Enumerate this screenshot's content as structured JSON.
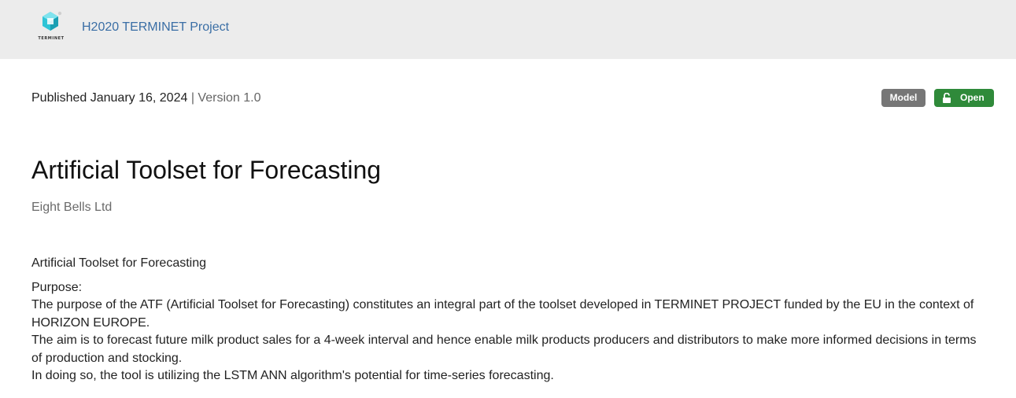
{
  "header": {
    "logo_text": "TERMINET",
    "community_label": "H2020 TERMINET Project",
    "brand_color": "#2ec4d6"
  },
  "record": {
    "published_label": "Published January 16, 2024",
    "version_label": "| Version 1.0",
    "badges": {
      "type": "Model",
      "access": "Open",
      "access_icon": "unlock-icon",
      "type_color": "#767676",
      "access_color": "#2f8a3a"
    },
    "title": "Artificial Toolset for Forecasting",
    "creator": "Eight Bells Ltd",
    "description": {
      "heading": "Artificial Toolset for Forecasting",
      "purpose_label": "Purpose:",
      "line1": "The purpose of the ATF (Artificial Toolset for Forecasting) constitutes an integral part of the toolset developed in TERMINET PROJECT funded by the EU in the context of HORIZON EUROPE.",
      "line2": "The aim is to forecast future milk product sales for a 4-week interval and hence enable milk products producers and distributors to make more informed decisions in terms of production and stocking.",
      "line3": "In doing so, the tool is utilizing the LSTM ANN algorithm's potential for time-series forecasting."
    }
  }
}
